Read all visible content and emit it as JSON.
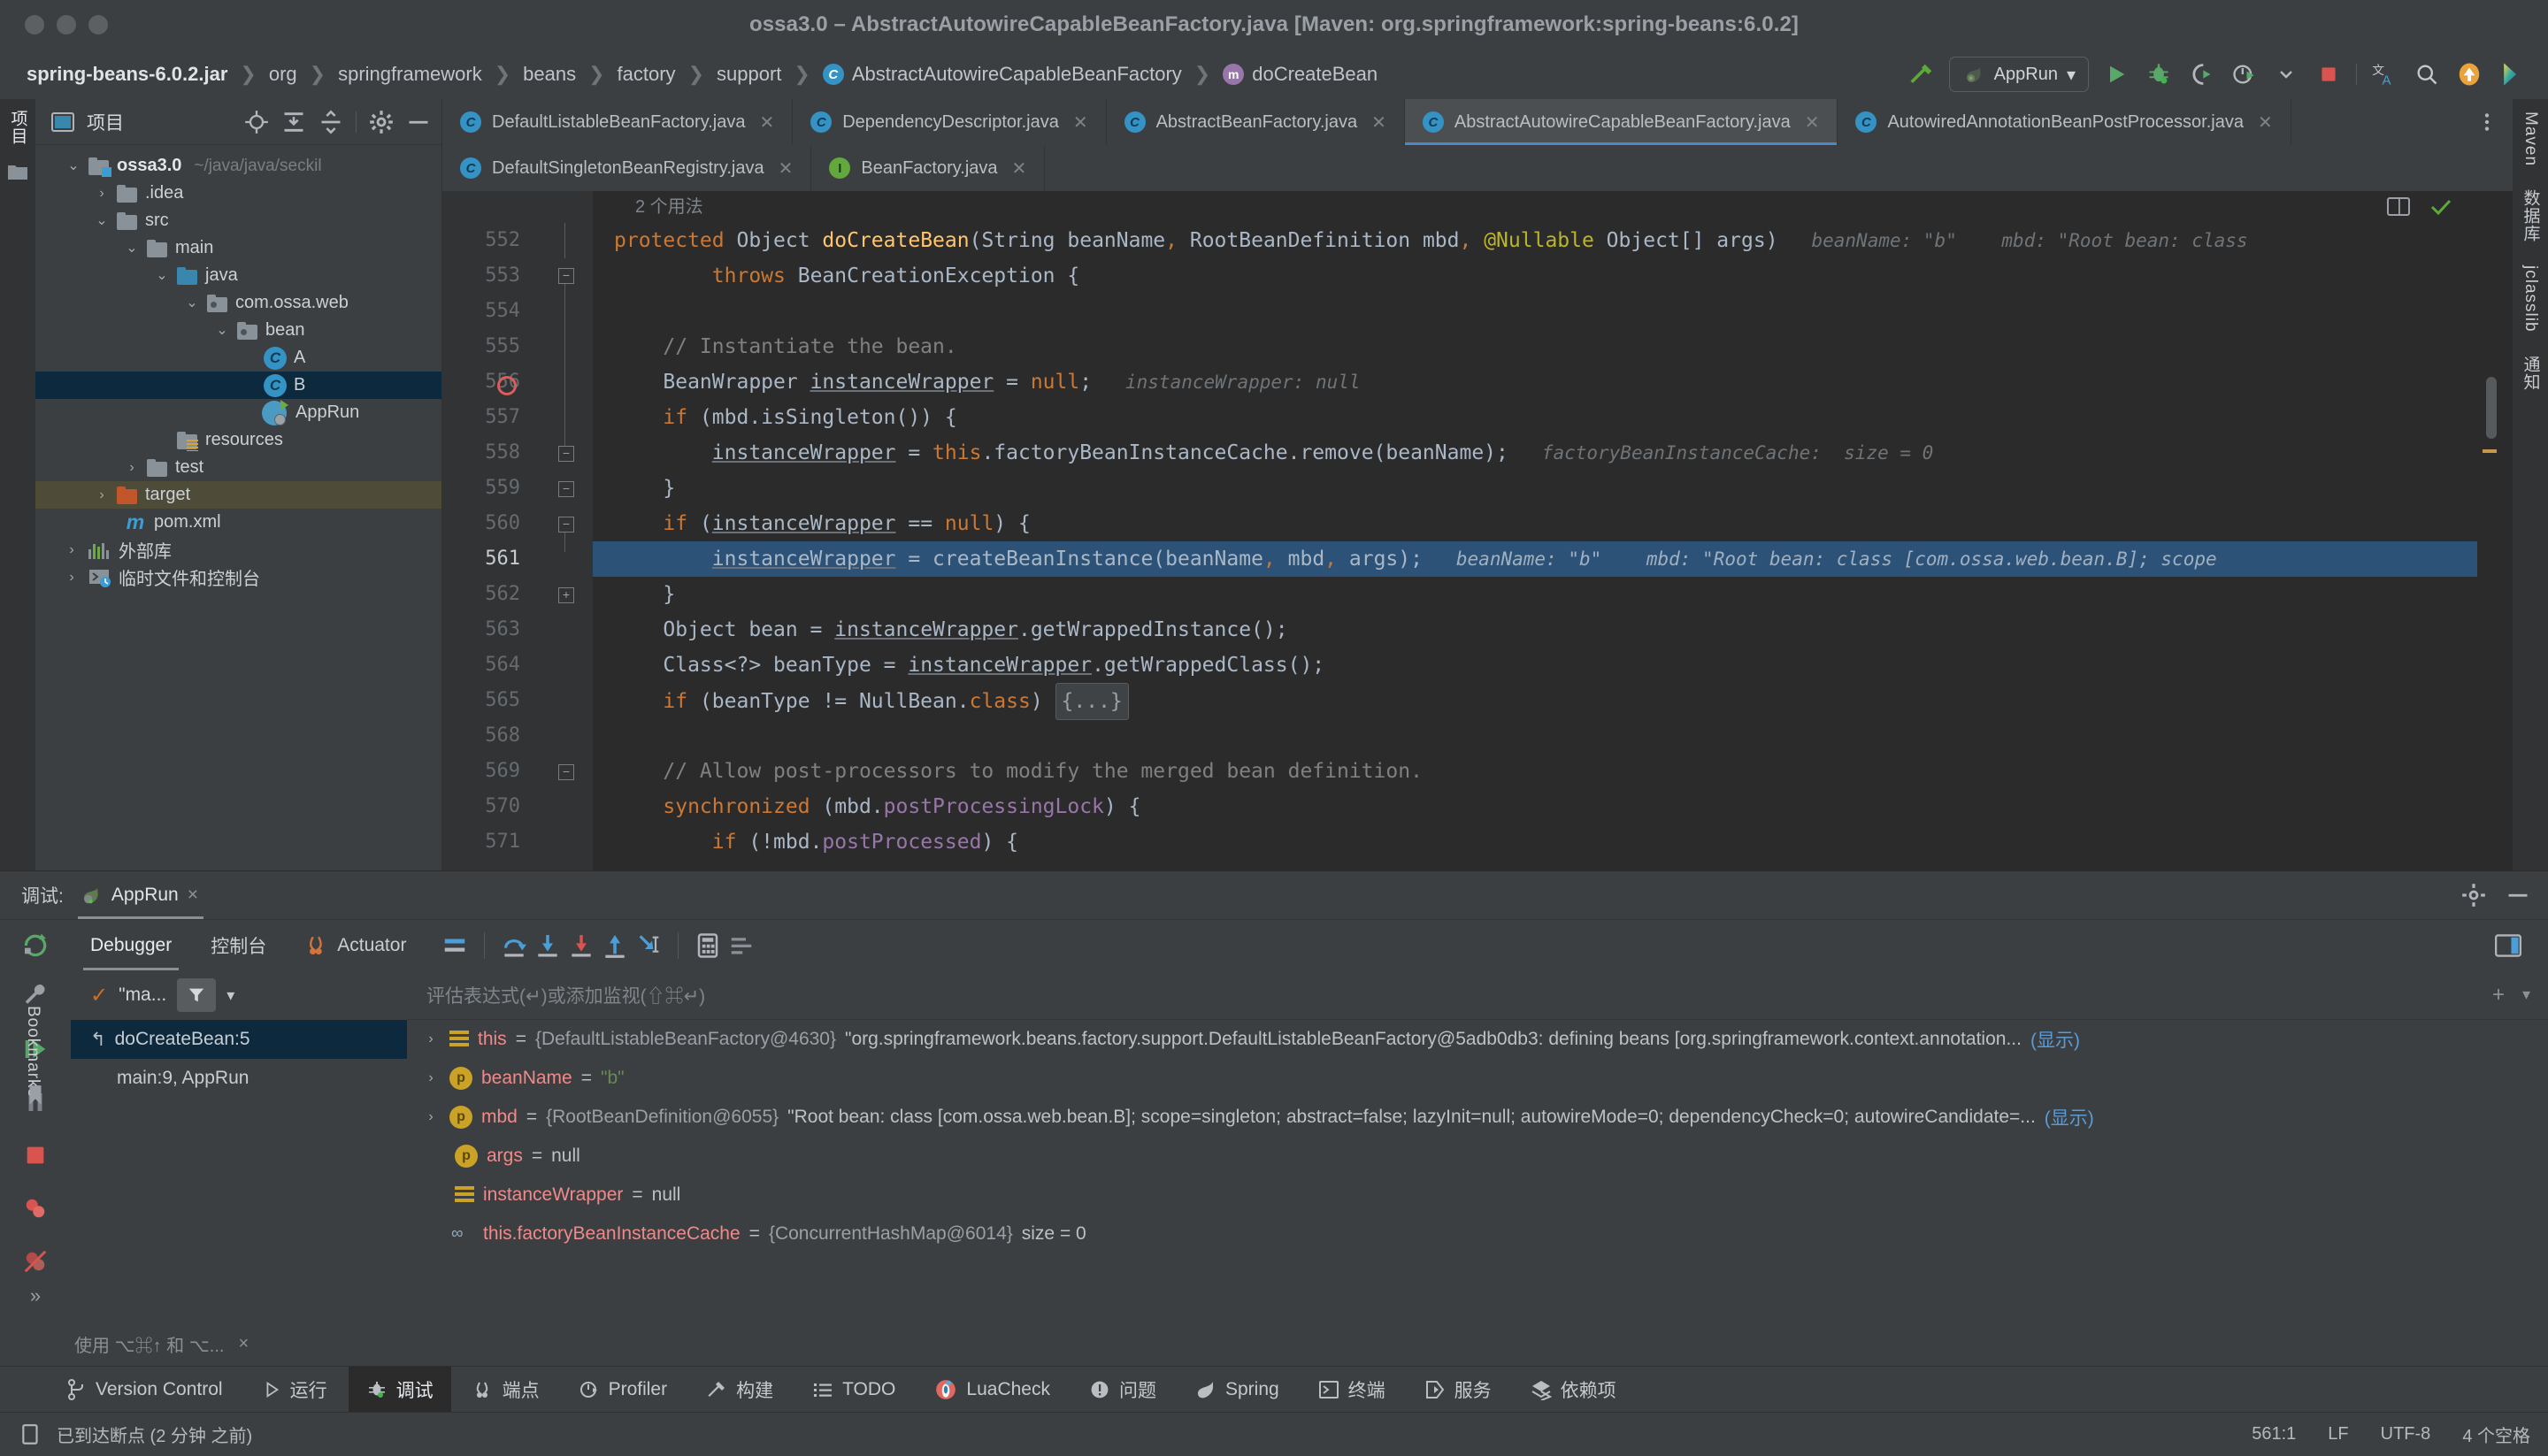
{
  "window": {
    "title": "ossa3.0 – AbstractAutowireCapableBeanFactory.java [Maven: org.springframework:spring-beans:6.0.2]"
  },
  "breadcrumb": {
    "items": [
      {
        "label": "spring-beans-6.0.2.jar",
        "icon": "none"
      },
      {
        "label": "org",
        "icon": "none"
      },
      {
        "label": "springframework",
        "icon": "none"
      },
      {
        "label": "beans",
        "icon": "none"
      },
      {
        "label": "factory",
        "icon": "none"
      },
      {
        "label": "support",
        "icon": "none"
      },
      {
        "label": "AbstractAutowireCapableBeanFactory",
        "icon": "class-badge"
      },
      {
        "label": "doCreateBean",
        "icon": "method-badge"
      }
    ]
  },
  "toolbar": {
    "build_icon": "hammer-icon",
    "run_config_label": "AppRun",
    "run_config_caret": "▾",
    "icons": [
      "run-icon",
      "debug-icon",
      "run-with-coverage-icon",
      "profiler-icon",
      "caret-down-icon",
      "stop-icon",
      "translate-icon",
      "search-icon",
      "updates-icon",
      "ide-feedback-icon"
    ]
  },
  "left_strip": {
    "items": [
      {
        "label": "项目",
        "name": "tool-window-project"
      },
      {
        "label": "",
        "name": "tool-window-commit-icon"
      }
    ]
  },
  "right_strip": {
    "items": [
      {
        "label": "Maven",
        "name": "tool-window-maven"
      },
      {
        "label": "数据库",
        "name": "tool-window-database"
      },
      {
        "label": "jclasslib",
        "name": "tool-window-jclasslib"
      },
      {
        "label": "通知",
        "name": "tool-window-notifications"
      }
    ]
  },
  "project_panel": {
    "title": "项目",
    "header_icons": [
      "locate-icon",
      "expand-all-icon",
      "collapse-all-icon",
      "settings-gear-icon",
      "hide-icon"
    ],
    "tree": [
      {
        "depth": 0,
        "label": "ossa3.0",
        "path": "~/java/java/seckil",
        "icon": "module-folder",
        "arrow": "down",
        "bold": true,
        "state": "normal"
      },
      {
        "depth": 1,
        "label": ".idea",
        "icon": "folder",
        "arrow": "right",
        "state": "normal"
      },
      {
        "depth": 1,
        "label": "src",
        "icon": "folder",
        "arrow": "down",
        "state": "normal"
      },
      {
        "depth": 2,
        "label": "main",
        "icon": "folder",
        "arrow": "down",
        "state": "normal"
      },
      {
        "depth": 3,
        "label": "java",
        "icon": "source-folder",
        "arrow": "down",
        "state": "normal"
      },
      {
        "depth": 4,
        "label": "com.ossa.web",
        "icon": "package",
        "arrow": "down",
        "state": "normal"
      },
      {
        "depth": 5,
        "label": "bean",
        "icon": "package",
        "arrow": "down",
        "state": "normal"
      },
      {
        "depth": 6,
        "label": "A",
        "icon": "class",
        "arrow": "none",
        "state": "normal"
      },
      {
        "depth": 6,
        "label": "B",
        "icon": "class",
        "arrow": "none",
        "state": "selected"
      },
      {
        "depth": 6,
        "label": "AppRun",
        "icon": "spring-runnable-class",
        "arrow": "none",
        "state": "normal"
      },
      {
        "depth": 3,
        "label": "resources",
        "icon": "resources-folder",
        "arrow": "none",
        "state": "normal"
      },
      {
        "depth": 2,
        "label": "test",
        "icon": "folder",
        "arrow": "right",
        "state": "normal"
      },
      {
        "depth": 1,
        "label": "target",
        "icon": "excluded-folder",
        "arrow": "right",
        "state": "highlighted"
      },
      {
        "depth": 2,
        "label": "pom.xml",
        "icon": "maven-m",
        "arrow": "none",
        "state": "normal"
      },
      {
        "depth": 0,
        "label": "外部库",
        "icon": "libraries",
        "arrow": "right",
        "state": "normal"
      },
      {
        "depth": 0,
        "label": "临时文件和控制台",
        "icon": "scratches",
        "arrow": "right",
        "state": "normal"
      }
    ]
  },
  "editor": {
    "tabs_row1": [
      {
        "label": "DefaultListableBeanFactory.java",
        "icon": "class",
        "active": false,
        "closable": true
      },
      {
        "label": "DependencyDescriptor.java",
        "icon": "class",
        "active": false,
        "closable": true
      },
      {
        "label": "AbstractBeanFactory.java",
        "icon": "abstract-class",
        "active": false,
        "closable": true
      },
      {
        "label": "AbstractAutowireCapableBeanFactory.java",
        "icon": "abstract-class",
        "active": true,
        "closable": true
      },
      {
        "label": "AutowiredAnnotationBeanPostProcessor.java",
        "icon": "class",
        "active": false,
        "closable": true
      }
    ],
    "tabs_row2": [
      {
        "label": "DefaultSingletonBeanRegistry.java",
        "icon": "class",
        "active": false,
        "closable": true
      },
      {
        "label": "BeanFactory.java",
        "icon": "interface",
        "active": false,
        "closable": true
      }
    ],
    "tabs_right_icons": [
      "more-tabs-icon"
    ],
    "usages_hint": "2 个用法",
    "inspection_ok_icon": "checkmark-icon",
    "reader_mode_icon": "reader-mode-icon",
    "lines": [
      {
        "n": "552",
        "fold": "none",
        "bp": false,
        "selected": false,
        "tokens": [
          {
            "t": "protected ",
            "c": "kw"
          },
          {
            "t": "Object ",
            "c": "cls"
          },
          {
            "t": "doCreateBean",
            "c": "fn"
          },
          {
            "t": "(",
            "c": "cls"
          },
          {
            "t": "String",
            "c": "cls"
          },
          {
            "t": " beanName",
            "c": "cls"
          },
          {
            "t": ", ",
            "c": "kw"
          },
          {
            "t": "RootBeanDefinition",
            "c": "cls"
          },
          {
            "t": " mbd",
            "c": "cls"
          },
          {
            "t": ", ",
            "c": "kw"
          },
          {
            "t": "@Nullable",
            "c": "ann"
          },
          {
            "t": " Object",
            "c": "cls"
          },
          {
            "t": "[] args",
            "c": "cls"
          },
          {
            "t": ")",
            "c": "cls"
          }
        ],
        "hint": "beanName: \"b\"    mbd: \"Root bean: class",
        "indent": 0
      },
      {
        "n": "553",
        "fold": "minus",
        "bp": false,
        "selected": false,
        "tokens": [
          {
            "t": "        ",
            "c": "cls"
          },
          {
            "t": "throws ",
            "c": "kw"
          },
          {
            "t": "BeanCreationException",
            "c": "cls"
          },
          {
            "t": " {",
            "c": "cls"
          }
        ],
        "hint": "",
        "indent": 0
      },
      {
        "n": "554",
        "fold": "none",
        "bp": false,
        "selected": false,
        "tokens": [],
        "hint": ""
      },
      {
        "n": "555",
        "fold": "none",
        "bp": false,
        "selected": false,
        "tokens": [
          {
            "t": "    // Instantiate the bean.",
            "c": "cmt"
          }
        ],
        "hint": ""
      },
      {
        "n": "556",
        "fold": "none",
        "bp": true,
        "selected": false,
        "tokens": [
          {
            "t": "    ",
            "c": "cls"
          },
          {
            "t": "BeanWrapper ",
            "c": "cls"
          },
          {
            "t": "instanceWrapper",
            "c": "ul"
          },
          {
            "t": " = ",
            "c": "cls"
          },
          {
            "t": "null",
            "c": "kw"
          },
          {
            "t": ";",
            "c": "cls"
          }
        ],
        "hint": "instanceWrapper: null"
      },
      {
        "n": "557",
        "fold": "minus",
        "bp": false,
        "selected": false,
        "tokens": [
          {
            "t": "    ",
            "c": "cls"
          },
          {
            "t": "if ",
            "c": "kw"
          },
          {
            "t": "(mbd.isSingleton()) {",
            "c": "cls"
          }
        ],
        "hint": ""
      },
      {
        "n": "558",
        "fold": "none",
        "bp": false,
        "selected": false,
        "tokens": [
          {
            "t": "        ",
            "c": "cls"
          },
          {
            "t": "instanceWrapper",
            "c": "ul"
          },
          {
            "t": " = ",
            "c": "cls"
          },
          {
            "t": "this",
            "c": "kw"
          },
          {
            "t": ".factoryBeanInstanceCache.remove(beanName);",
            "c": "cls"
          }
        ],
        "hint": "factoryBeanInstanceCache:  size = 0"
      },
      {
        "n": "559",
        "fold": "minus",
        "bp": false,
        "selected": false,
        "tokens": [
          {
            "t": "    }",
            "c": "cls"
          }
        ],
        "hint": ""
      },
      {
        "n": "560",
        "fold": "minus",
        "bp": false,
        "selected": false,
        "tokens": [
          {
            "t": "    ",
            "c": "cls"
          },
          {
            "t": "if ",
            "c": "kw"
          },
          {
            "t": "(",
            "c": "cls"
          },
          {
            "t": "instanceWrapper",
            "c": "ul"
          },
          {
            "t": " == ",
            "c": "cls"
          },
          {
            "t": "null",
            "c": "kw"
          },
          {
            "t": ") {",
            "c": "cls"
          }
        ],
        "hint": ""
      },
      {
        "n": "561",
        "fold": "none",
        "bp": false,
        "selected": true,
        "tokens": [
          {
            "t": "        ",
            "c": "cls"
          },
          {
            "t": "instanceWrapper",
            "c": "ul"
          },
          {
            "t": " = createBeanInstance(beanName",
            "c": "cls"
          },
          {
            "t": ", ",
            "c": "kw"
          },
          {
            "t": "mbd",
            "c": "cls"
          },
          {
            "t": ", ",
            "c": "kw"
          },
          {
            "t": "args);",
            "c": "cls"
          }
        ],
        "hint": "beanName: \"b\"    mbd: \"Root bean: class [com.ossa.web.bean.B]; scope"
      },
      {
        "n": "562",
        "fold": "none",
        "bp": false,
        "selected": false,
        "tokens": [
          {
            "t": "    }",
            "c": "cls"
          }
        ],
        "hint": ""
      },
      {
        "n": "563",
        "fold": "none",
        "bp": false,
        "selected": false,
        "tokens": [
          {
            "t": "    Object bean = ",
            "c": "cls"
          },
          {
            "t": "instanceWrapper",
            "c": "ul"
          },
          {
            "t": ".getWrappedInstance();",
            "c": "cls"
          }
        ],
        "hint": ""
      },
      {
        "n": "564",
        "fold": "none",
        "bp": false,
        "selected": false,
        "tokens": [
          {
            "t": "    Class<?> beanType = ",
            "c": "cls"
          },
          {
            "t": "instanceWrapper",
            "c": "ul"
          },
          {
            "t": ".getWrappedClass();",
            "c": "cls"
          }
        ],
        "hint": ""
      },
      {
        "n": "565",
        "fold": "plus",
        "bp": false,
        "selected": false,
        "tokens": [
          {
            "t": "    ",
            "c": "cls"
          },
          {
            "t": "if ",
            "c": "kw"
          },
          {
            "t": "(beanType != NullBean.",
            "c": "cls"
          },
          {
            "t": "class",
            "c": "kw"
          },
          {
            "t": ") ",
            "c": "cls"
          },
          {
            "t": "{...}",
            "c": "box"
          }
        ],
        "hint": ""
      },
      {
        "n": "568",
        "fold": "none",
        "bp": false,
        "selected": false,
        "tokens": [],
        "hint": ""
      },
      {
        "n": "569",
        "fold": "none",
        "bp": false,
        "selected": false,
        "tokens": [
          {
            "t": "    // Allow post-processors to modify the merged bean definition.",
            "c": "cmt"
          }
        ],
        "hint": ""
      },
      {
        "n": "570",
        "fold": "none",
        "bp": false,
        "selected": false,
        "tokens": [
          {
            "t": "    ",
            "c": "cls"
          },
          {
            "t": "synchronized ",
            "c": "kw"
          },
          {
            "t": "(mbd.",
            "c": "cls"
          },
          {
            "t": "postProcessingLock",
            "c": "fld"
          },
          {
            "t": ") {",
            "c": "cls"
          }
        ],
        "hint": ""
      },
      {
        "n": "571",
        "fold": "minus",
        "bp": false,
        "selected": false,
        "tokens": [
          {
            "t": "        ",
            "c": "cls"
          },
          {
            "t": "if ",
            "c": "kw"
          },
          {
            "t": "(!mbd.",
            "c": "cls"
          },
          {
            "t": "postProcessed",
            "c": "fld"
          },
          {
            "t": ") {",
            "c": "cls"
          }
        ],
        "hint": ""
      }
    ]
  },
  "debug_panel": {
    "label": "调试:",
    "session_tab": "AppRun",
    "session_close": "×",
    "header_icons": [
      "settings-gear-icon",
      "hide-icon"
    ],
    "tabs": [
      {
        "label": "Debugger",
        "active": true,
        "icon": "none"
      },
      {
        "label": "控制台",
        "active": false,
        "icon": "none"
      },
      {
        "label": "Actuator",
        "active": false,
        "icon": "actuator-icon"
      }
    ],
    "toolbar_icons": [
      "rerun-icon",
      "layout-icon",
      "step-over-icon",
      "step-into-icon",
      "force-step-into-icon",
      "step-out-icon",
      "run-to-cursor-icon",
      "evaluate-icon",
      "settings-list-icon",
      "layout-settings-icon"
    ],
    "frames_filter": "\"ma...",
    "frames_filter_check": "✓",
    "frames": [
      {
        "label": "doCreateBean:5",
        "selected": true,
        "icon": "frame-icon"
      },
      {
        "label": "main:9, AppRun",
        "selected": false,
        "icon": "none"
      }
    ],
    "watch_placeholder": "评估表达式(↵)或添加监视(⇧⌘↵)",
    "variables": [
      {
        "expandable": true,
        "icon": "object-icon",
        "name": "this",
        "eq": " = ",
        "ref": "{DefaultListableBeanFactory@4630}",
        "value": "\"org.springframework.beans.factory.support.DefaultListableBeanFactory@5adb0db3: defining beans [org.springframework.context.annotation...",
        "link": "(显示)"
      },
      {
        "expandable": true,
        "icon": "param-icon",
        "name": "beanName",
        "eq": " = ",
        "ref": "",
        "value": "\"b\"",
        "value_kind": "string",
        "link": ""
      },
      {
        "expandable": true,
        "icon": "param-icon",
        "name": "mbd",
        "eq": " = ",
        "ref": "{RootBeanDefinition@6055}",
        "value": "\"Root bean: class [com.ossa.web.bean.B]; scope=singleton; abstract=false; lazyInit=null; autowireMode=0; dependencyCheck=0; autowireCandidate=...",
        "link": "(显示)"
      },
      {
        "expandable": false,
        "icon": "param-icon",
        "name": "args",
        "eq": " = ",
        "ref": "",
        "value": "null",
        "link": ""
      },
      {
        "expandable": false,
        "icon": "object-icon",
        "name": "instanceWrapper",
        "eq": " = ",
        "ref": "",
        "value": "null",
        "link": ""
      },
      {
        "expandable": false,
        "icon": "field-link-icon",
        "name": "this.factoryBeanInstanceCache",
        "eq": " = ",
        "ref": "{ConcurrentHashMap@6014}",
        "value": "size = 0",
        "link": ""
      }
    ],
    "hint_bar": "使用 ⌥⌘↑ 和 ⌥...",
    "hint_close": "×",
    "expand_icon": "»"
  },
  "tool_window_bar": {
    "items": [
      {
        "label": "Version Control",
        "icon": "vcs-icon",
        "active": false
      },
      {
        "label": "运行",
        "icon": "run-icon",
        "active": false
      },
      {
        "label": "调试",
        "icon": "debug-bug-icon",
        "active": true
      },
      {
        "label": "端点",
        "icon": "endpoints-icon",
        "active": false
      },
      {
        "label": "Profiler",
        "icon": "profiler-icon",
        "active": false
      },
      {
        "label": "构建",
        "icon": "build-hammer-icon",
        "active": false
      },
      {
        "label": "TODO",
        "icon": "todo-list-icon",
        "active": false
      },
      {
        "label": "LuaCheck",
        "icon": "luacheck-icon",
        "active": false
      },
      {
        "label": "问题",
        "icon": "problems-icon",
        "active": false
      },
      {
        "label": "Spring",
        "icon": "spring-leaf-icon",
        "active": false
      },
      {
        "label": "终端",
        "icon": "terminal-icon",
        "active": false
      },
      {
        "label": "服务",
        "icon": "services-icon",
        "active": false
      },
      {
        "label": "依赖项",
        "icon": "dependencies-icon",
        "active": false
      }
    ]
  },
  "status_bar": {
    "message_icon": "memory-icon",
    "message": "已到达断点 (2 分钟 之前)",
    "caret_position": "561:1",
    "line_separator": "LF",
    "encoding": "UTF-8",
    "indent": "4 个空格"
  },
  "bookmarks_label": "Bookmarks",
  "colors": {
    "accent_blue": "#3592c4",
    "selection_blue": "#2d5278",
    "tree_selection": "#0d293e",
    "excluded_highlight": "#4e4b38",
    "breakpoint_red": "#db5c5c",
    "keyword_orange": "#cc7832",
    "string_green": "#6a8759",
    "method_yellow": "#ffc66d",
    "annotation_olive": "#bbb529",
    "field_purple": "#9876aa",
    "var_name_pink": "#ef8a8a",
    "bg_editor": "#2b2b2b",
    "bg_panel": "#3c3f41"
  }
}
